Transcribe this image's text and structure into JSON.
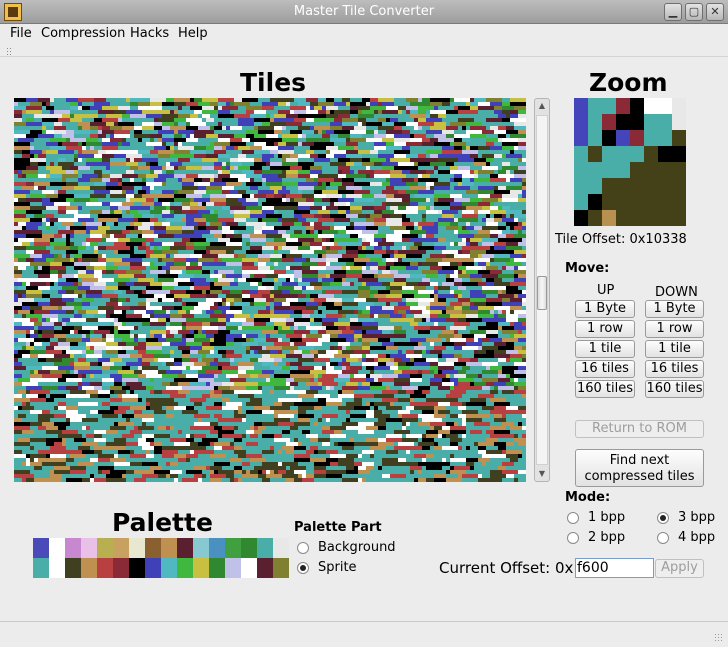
{
  "window": {
    "title": "Master Tile Converter"
  },
  "menu": [
    "File",
    "Compression",
    "Hacks",
    "Help"
  ],
  "tiles": {
    "heading": "Tiles"
  },
  "zoom": {
    "heading": "Zoom",
    "tile_offset_label": "Tile Offset: 0x10338",
    "pixels": [
      [
        3,
        1,
        1,
        5,
        0,
        7,
        7,
        4
      ],
      [
        3,
        1,
        5,
        0,
        0,
        1,
        1,
        4
      ],
      [
        3,
        1,
        0,
        3,
        5,
        1,
        1,
        6
      ],
      [
        1,
        6,
        1,
        1,
        1,
        6,
        0,
        0
      ],
      [
        1,
        1,
        1,
        1,
        6,
        6,
        6,
        6
      ],
      [
        1,
        1,
        6,
        6,
        6,
        6,
        6,
        6
      ],
      [
        1,
        0,
        6,
        6,
        6,
        6,
        6,
        6
      ],
      [
        0,
        6,
        8,
        6,
        6,
        6,
        6,
        6
      ]
    ],
    "colors": [
      "#000000",
      "#4aaea8",
      "#3a3a8a",
      "#4444bb",
      "#e8e8e8",
      "#8a2a36",
      "#444018",
      "#ffffff",
      "#b89050"
    ]
  },
  "move": {
    "label": "Move:",
    "up_label": "UP",
    "down_label": "DOWN",
    "up_buttons": [
      "1 Byte",
      "1 row",
      "1 tile",
      "16 tiles",
      "160 tiles"
    ],
    "down_buttons": [
      "1 Byte",
      "1 row",
      "1 tile",
      "16 tiles",
      "160 tiles"
    ],
    "return_label": "Return to ROM",
    "find_label_line1": "Find next",
    "find_label_line2": "compressed tiles"
  },
  "mode": {
    "label": "Mode:",
    "options": [
      "1 bpp",
      "3 bpp",
      "2 bpp",
      "4 bpp"
    ],
    "selected": "3 bpp"
  },
  "palette": {
    "heading": "Palette",
    "part_label": "Palette Part",
    "parts": [
      "Background",
      "Sprite"
    ],
    "selected_part": "Sprite",
    "row1": [
      "#4a4ab8",
      "#ffffff",
      "#c888d0",
      "#e8c0e8",
      "#b8b050",
      "#c8a060",
      "#e8e8d0",
      "#8a6030",
      "#c09050",
      "#5a2030",
      "#88c8d0",
      "#4a90c0",
      "#40a040",
      "#308830",
      "#4aaea8",
      "#e8e8e8"
    ],
    "row2": [
      "#4aaea8",
      "#ffffff",
      "#404020",
      "#c09050",
      "#b84040",
      "#8a2a36",
      "#000000",
      "#4040b8",
      "#50b8c0",
      "#40b840",
      "#c8c040",
      "#308830",
      "#c0c0e8",
      "#ffffff",
      "#5a2030",
      "#808030"
    ]
  },
  "offset": {
    "label": "Current Offset: 0x",
    "value": "f600",
    "apply_label": "Apply"
  }
}
